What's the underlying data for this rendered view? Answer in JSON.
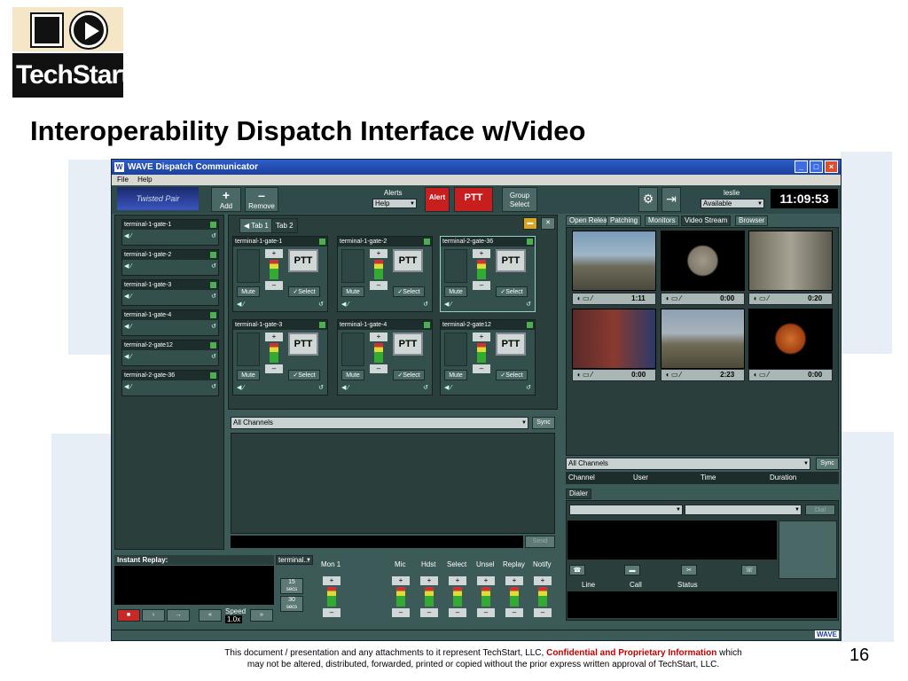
{
  "logo": {
    "brand": "TechStart"
  },
  "slide_title": "Interoperability Dispatch Interface w/Video",
  "window": {
    "title": "WAVE Dispatch Communicator",
    "menu": [
      "File",
      "Help"
    ],
    "toolbar": {
      "logo_text": "Twisted Pair",
      "add": "Add",
      "remove": "Remove",
      "alerts_label": "Alerts",
      "alerts_value": "Help",
      "alert": "Alert",
      "ptt": "PTT",
      "group_select_1": "Group",
      "group_select_2": "Select",
      "user": "leslie",
      "status": "Available",
      "clock": "11:09:53"
    },
    "gates": [
      "terminal-1-gate-1",
      "terminal-1-gate-2",
      "terminal-1-gate-3",
      "terminal-1-gate-4",
      "terminal-2-gate12",
      "terminal-2-gate-36"
    ],
    "tabs": [
      "Tab 1",
      "Tab 2"
    ],
    "cards": [
      {
        "name": "terminal-1-gate-1"
      },
      {
        "name": "terminal-1-gate-2"
      },
      {
        "name": "terminal-2-gate-36"
      },
      {
        "name": "terminal-1-gate-3"
      },
      {
        "name": "terminal-1-gate-4"
      },
      {
        "name": "terminal-2-gate12"
      }
    ],
    "card_labels": {
      "ptt": "PTT",
      "mute": "Mute",
      "select": "Select",
      "plus": "+",
      "minus": "–"
    },
    "channels": {
      "label": "All Channels",
      "sync": "Sync",
      "send": "Send"
    },
    "video_tabs": [
      "Open Release",
      "Patching",
      "Monitors",
      "Video Stream",
      "Browser"
    ],
    "video_times": [
      "1:11",
      "0:00",
      "0:20",
      "0:00",
      "2:23",
      "0:00"
    ],
    "right_channels": {
      "label": "All Channels",
      "sync": "Sync",
      "columns": [
        "Channel",
        "User",
        "Time",
        "Duration"
      ]
    },
    "dialer": {
      "tab": "Dialer",
      "dial": "Dial",
      "columns": [
        "Line",
        "Call",
        "Status"
      ]
    },
    "replay": {
      "title": "Instant Replay:",
      "terminal": "terminal...",
      "b15": "15",
      "b30": "30",
      "sec": "secs",
      "speed": "Speed",
      "speed_val": "1.0x"
    },
    "monitor_labels": [
      "Mon 1",
      "Mic",
      "Hdst",
      "Select",
      "Unsel",
      "Replay",
      "Notify"
    ],
    "wave": "WAVE"
  },
  "footer": {
    "line1_pre": "This document / presentation and any attachments to it represent TechStart, LLC,",
    "conf": "Confidential and Proprietary Information",
    "line1_post": "which",
    "line2": "may not be altered, distributed, forwarded, printed or copied without the prior express written approval of TechStart, LLC."
  },
  "page_number": "16"
}
